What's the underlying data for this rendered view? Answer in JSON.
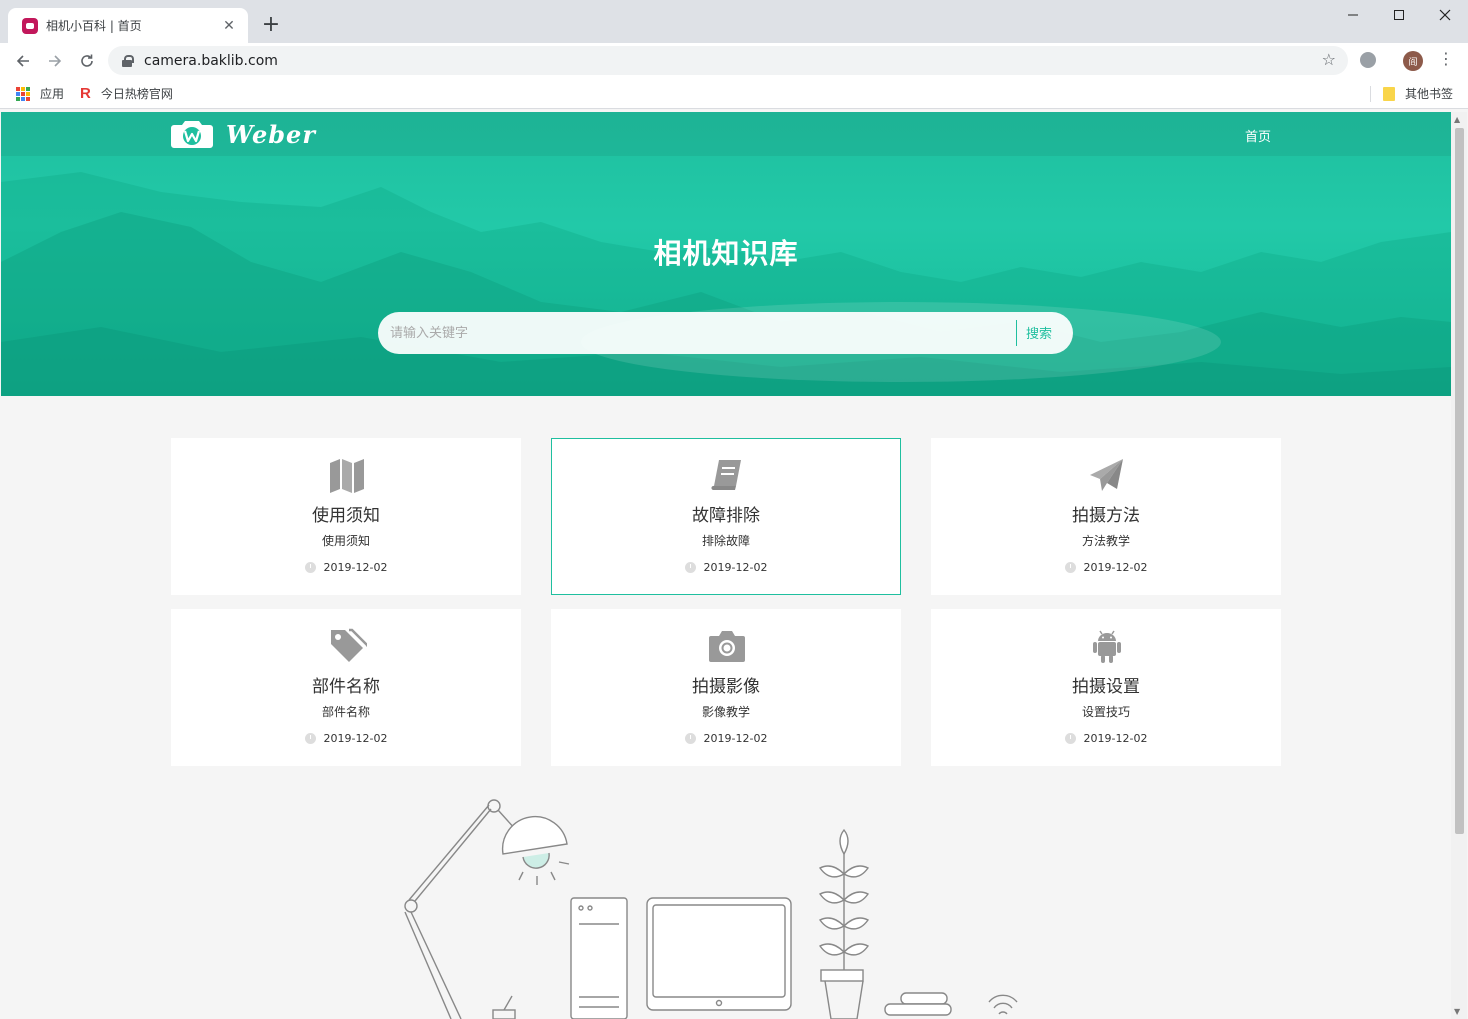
{
  "browser": {
    "tab_title": "相机小百科 | 首页",
    "tab_close": "✕",
    "new_tab": "+",
    "url": "camera.baklib.com",
    "avatar_letter": "阎",
    "bookmarks": [
      {
        "label": "应用"
      },
      {
        "label": "今日热榜官网"
      },
      {
        "label": "其他书签"
      }
    ]
  },
  "site": {
    "logo_text": "Weber",
    "nav_home": "首页",
    "hero_title": "相机知识库",
    "search_placeholder": "请输入关键字",
    "search_button": "搜索",
    "accent_color": "#1fbf9f"
  },
  "cards": [
    {
      "title": "使用须知",
      "subtitle": "使用须知",
      "date": "2019-12-02",
      "icon": "map-icon"
    },
    {
      "title": "故障排除",
      "subtitle": "排除故障",
      "date": "2019-12-02",
      "icon": "book-icon"
    },
    {
      "title": "拍摄方法",
      "subtitle": "方法教学",
      "date": "2019-12-02",
      "icon": "paper-plane-icon"
    },
    {
      "title": "部件名称",
      "subtitle": "部件名称",
      "date": "2019-12-02",
      "icon": "tags-icon"
    },
    {
      "title": "拍摄影像",
      "subtitle": "影像教学",
      "date": "2019-12-02",
      "icon": "camera-icon"
    },
    {
      "title": "拍摄设置",
      "subtitle": "设置技巧",
      "date": "2019-12-02",
      "icon": "android-icon"
    }
  ]
}
